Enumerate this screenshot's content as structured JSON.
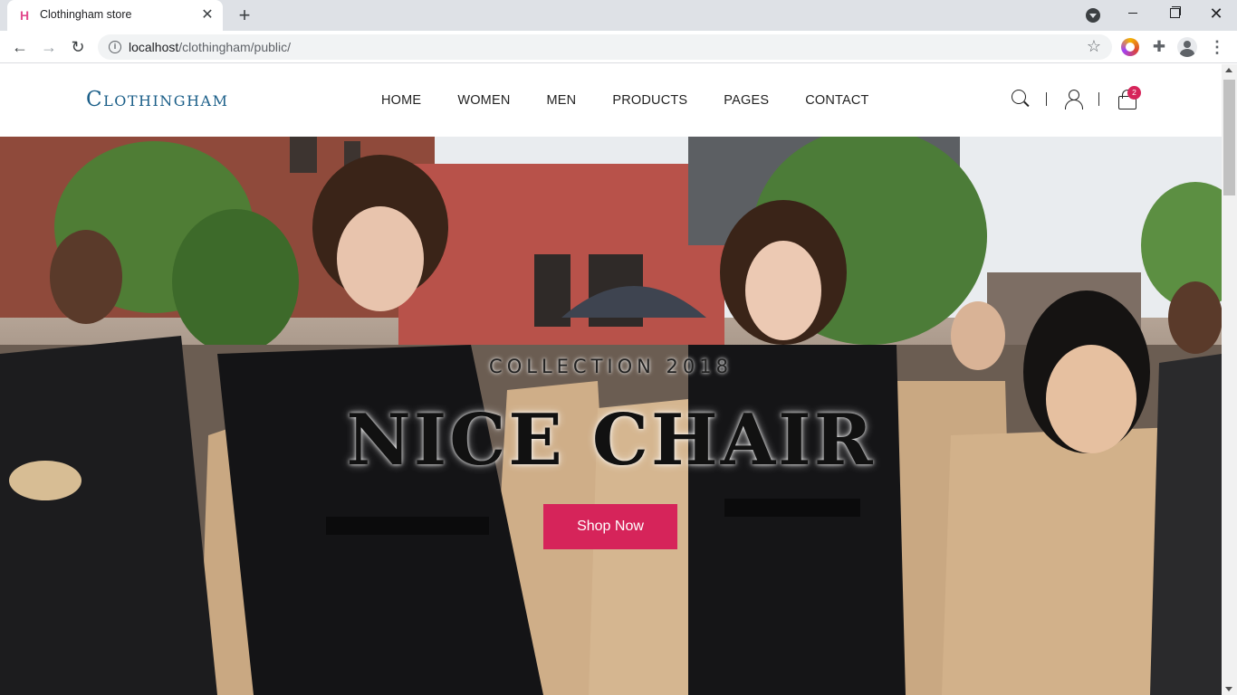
{
  "browser": {
    "tab_title": "Clothingham store",
    "url_host": "localhost",
    "url_path": "/clothingham/public/"
  },
  "site": {
    "logo": "Clothingham",
    "nav": [
      "HOME",
      "WOMEN",
      "MEN",
      "PRODUCTS",
      "PAGES",
      "CONTACT"
    ],
    "cart_count": "2",
    "icons": [
      "search-icon",
      "user-icon",
      "cart-icon"
    ]
  },
  "hero": {
    "subtitle": "COLLECTION 2018",
    "title": "NICE CHAIR",
    "cta": "Shop Now"
  },
  "colors": {
    "accent": "#d6245a",
    "logo": "#1a5e88"
  }
}
